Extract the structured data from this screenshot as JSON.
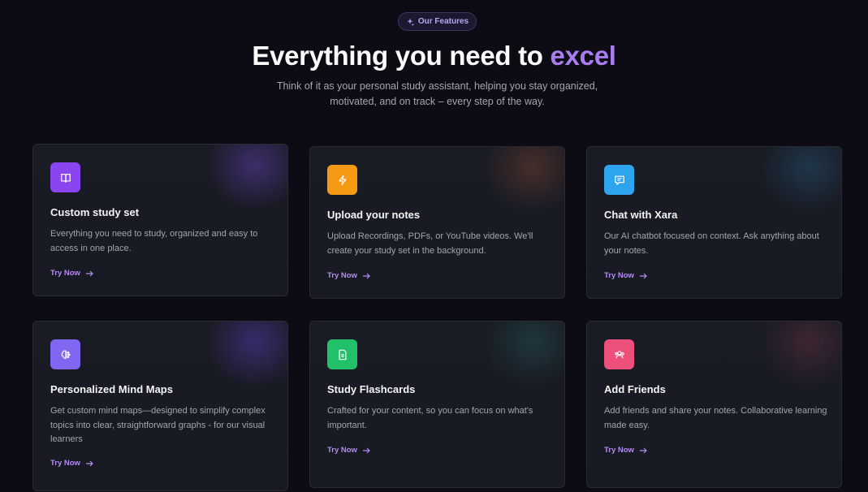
{
  "badge": {
    "label": "Our Features",
    "icon": "sparkles-icon"
  },
  "headline": {
    "prefix": "Everything you need to",
    "accent": "excel"
  },
  "subtitle": "Think of it as your personal study assistant, helping you stay organized, motivated, and on track – every step of the way.",
  "colors": {
    "accent": "#a97cf0",
    "background": "#0d0b14",
    "card": "#1a1c25"
  },
  "cards": [
    {
      "title": "Custom study set",
      "description": "Everything you need to study, organized and easy to access in one place.",
      "cta": "Try Now",
      "icon": "book-icon",
      "icon_color": "#8b45f0"
    },
    {
      "title": "Upload your notes",
      "description": "Upload Recordings, PDFs, or YouTube videos. We'll create your study set in the background.",
      "cta": "Try Now",
      "icon": "lightning-icon",
      "icon_color": "#f59a12"
    },
    {
      "title": "Chat with Xara",
      "description": "Our AI chatbot focused on context. Ask anything about your notes.",
      "cta": "Try Now",
      "icon": "chat-icon",
      "icon_color": "#2ea3ee"
    },
    {
      "title": "Personalized Mind Maps",
      "description": "Get custom mind maps—designed to simplify complex topics into clear, straightforward graphs - for our visual learners",
      "cta": "Try Now",
      "icon": "brain-icon",
      "icon_color": "#8166f2"
    },
    {
      "title": "Study Flashcards",
      "description": "Crafted for your content, so you can focus on what's important.",
      "cta": "Try Now",
      "icon": "flashcard-icon",
      "icon_color": "#23c06a"
    },
    {
      "title": "Add Friends",
      "description": "Add friends and share your notes. Collaborative learning made easy.",
      "cta": "Try Now",
      "icon": "friends-icon",
      "icon_color": "#ec4f79"
    }
  ]
}
